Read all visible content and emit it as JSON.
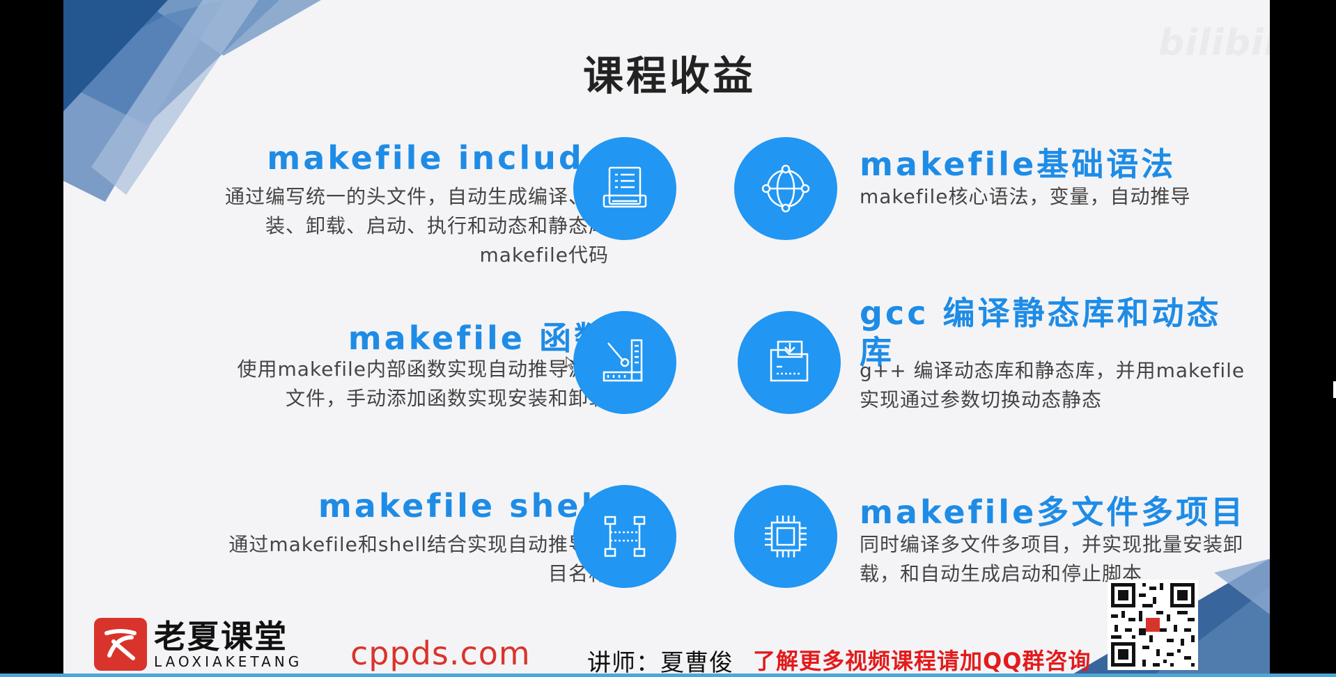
{
  "slide": {
    "title": "课程收益",
    "watermark": "bilibili"
  },
  "items": [
    {
      "heading": "makefile include",
      "description": "通过编写统一的头文件，自动生成编译、安装、卸载、启动、执行和动态和静态库makefile代码",
      "icon": "document-list-icon"
    },
    {
      "heading": "makefile基础语法",
      "description": "makefile核心语法，变量，自动推导",
      "icon": "globe-network-icon"
    },
    {
      "heading": "makefile 函数",
      "description": "使用makefile内部函数实现自动推导源码文件，手动添加函数实现安装和卸载",
      "icon": "design-tools-icon"
    },
    {
      "heading": "gcc 编译静态库和动态库",
      "description": "g++ 编译动态库和静态库，并用makefile实现通过参数切换动态静态",
      "icon": "folder-download-icon"
    },
    {
      "heading": "makefile shell",
      "description": "通过makefile和shell结合实现自动推导项目名称",
      "icon": "network-nodes-icon"
    },
    {
      "heading": "makefile多文件多项目",
      "description": "同时编译多文件多项目，并实现批量安装卸载，和自动生成启动和停止脚本",
      "icon": "cpu-chip-icon"
    }
  ],
  "footer": {
    "logo_cn": "老夏课堂",
    "logo_en": "LAOXIAKETANG",
    "url": "cppds.com",
    "teacher": "讲师：夏曹俊",
    "promo": "了解更多视频课程请加QQ群咨询"
  },
  "colors": {
    "accent": "#2196f3",
    "heading": "#1e8ce6",
    "promo": "#e21b1b",
    "brand_red": "#d9342b"
  }
}
